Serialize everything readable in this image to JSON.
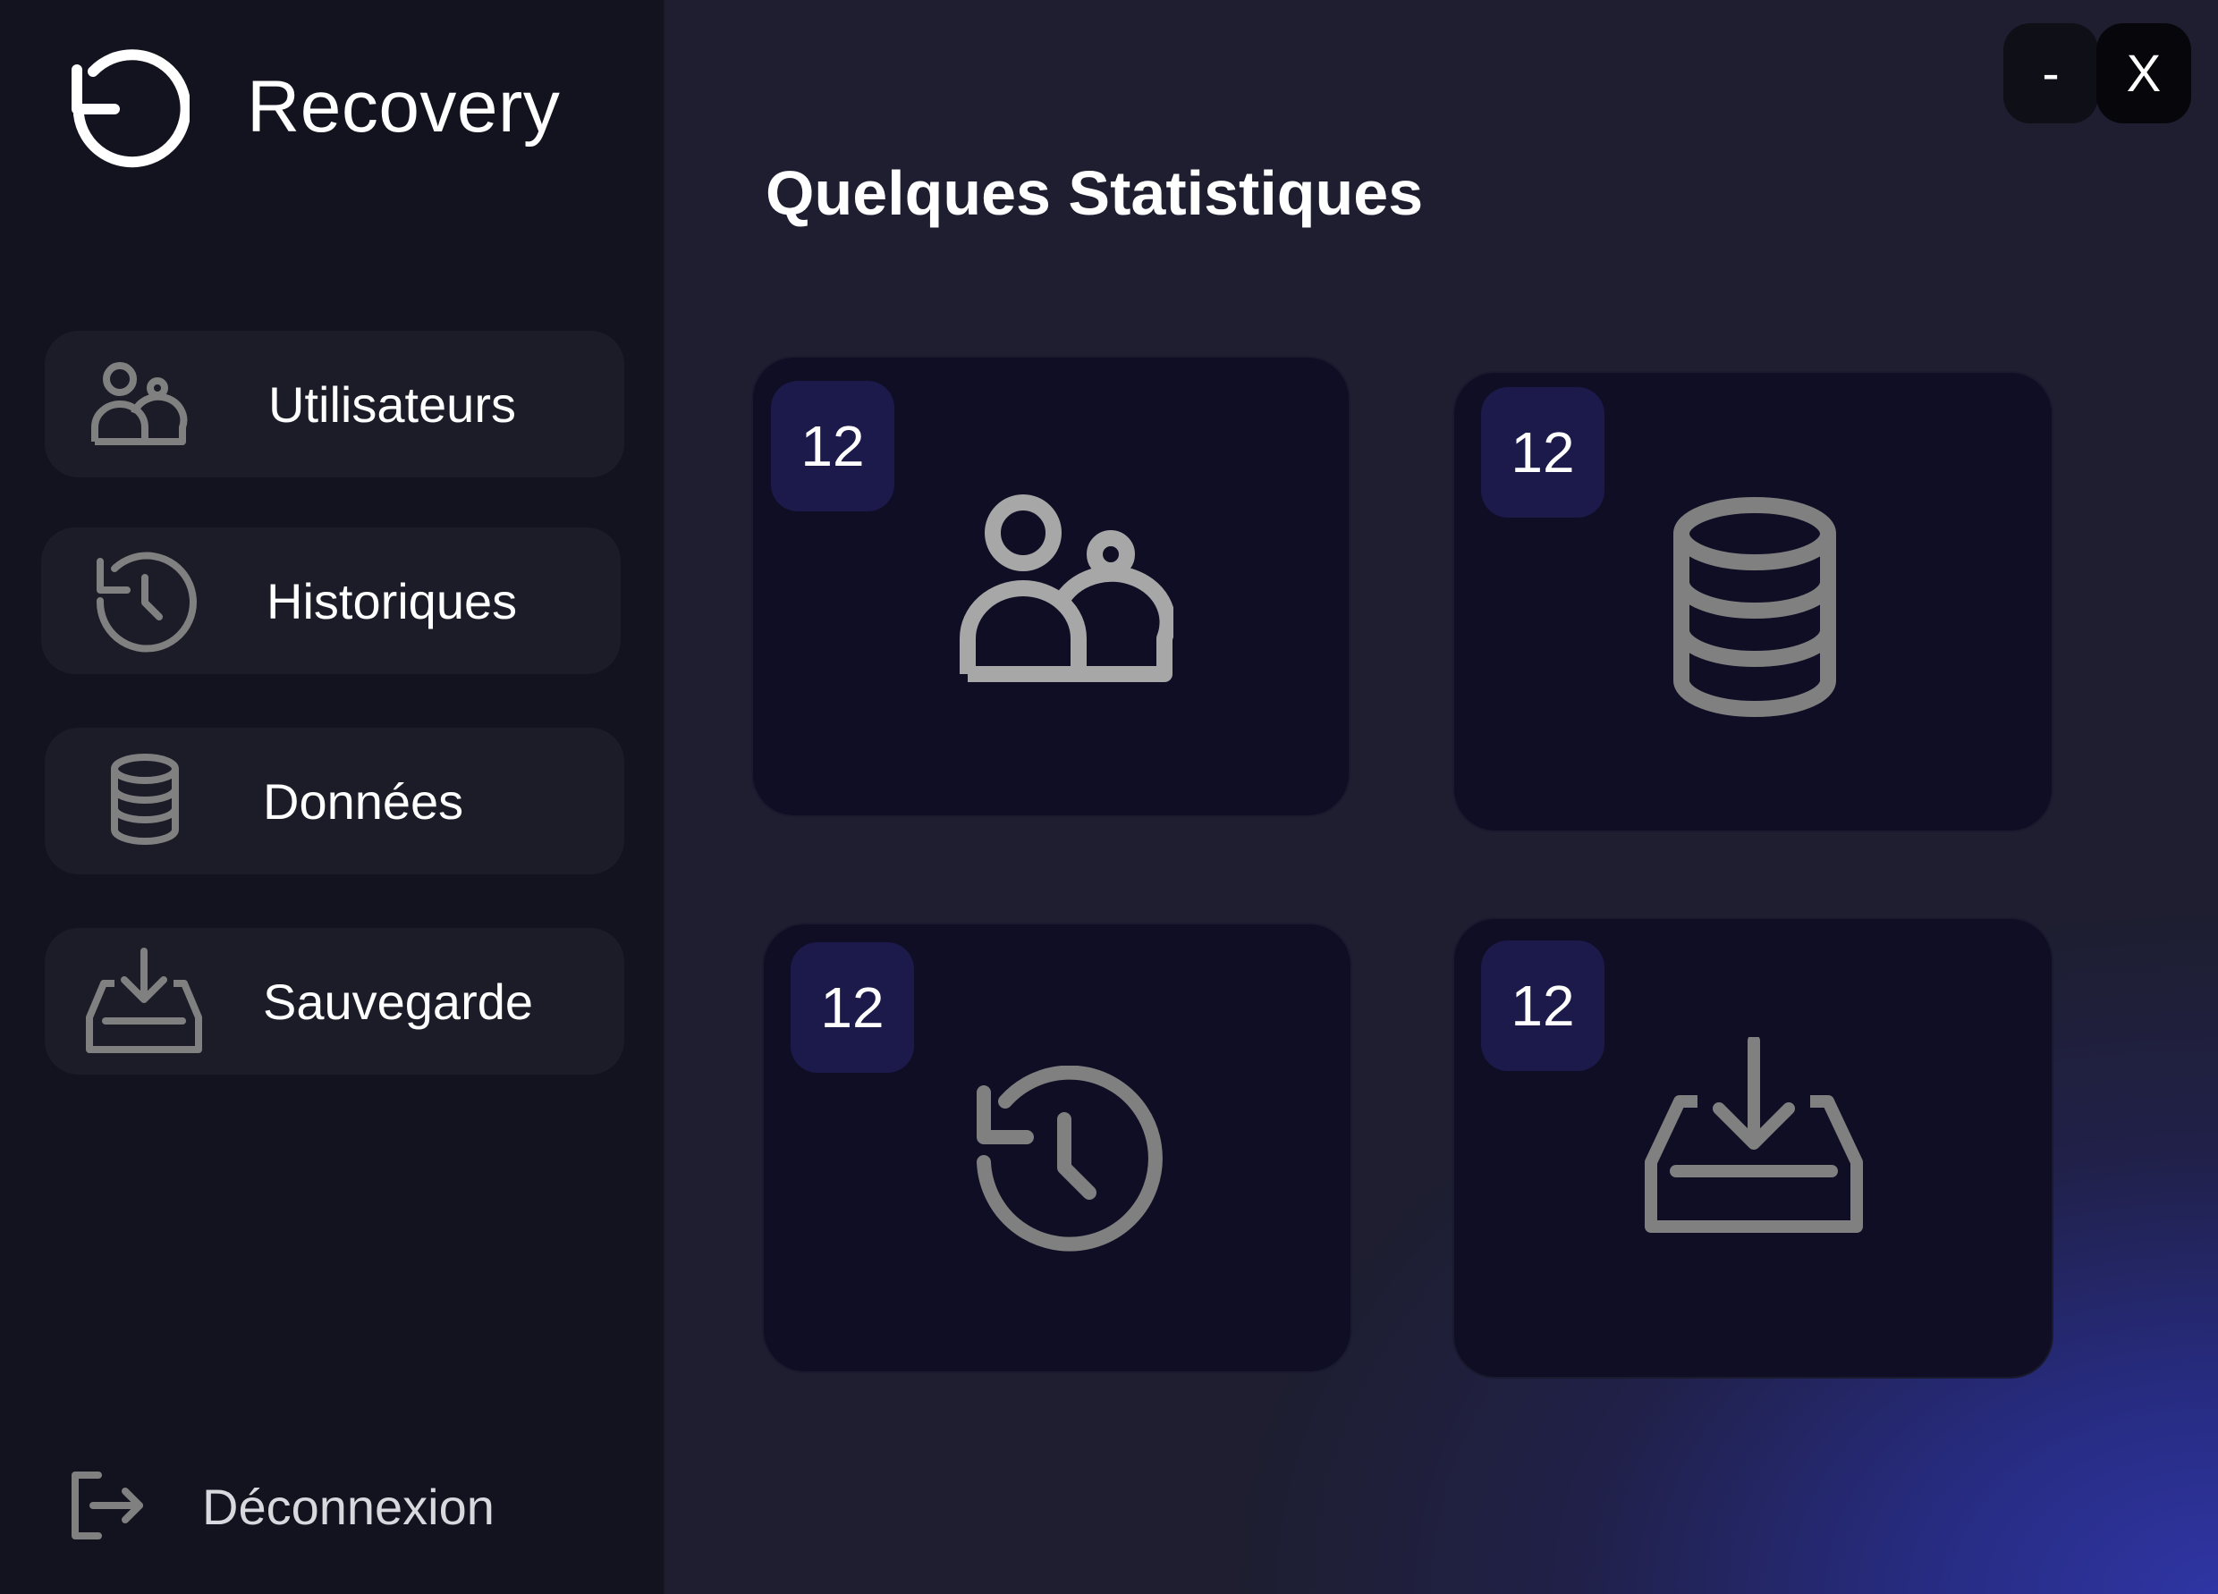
{
  "app": {
    "title": "Recovery",
    "icon": "refresh-ccw-icon"
  },
  "sidebar": {
    "items": [
      {
        "label": "Utilisateurs",
        "icon": "users-icon"
      },
      {
        "label": "Historiques",
        "icon": "history-icon"
      },
      {
        "label": "Données",
        "icon": "database-icon"
      },
      {
        "label": "Sauvegarde",
        "icon": "download-tray-icon"
      }
    ],
    "logout": {
      "label": "Déconnexion",
      "icon": "logout-icon"
    }
  },
  "window_controls": {
    "minimize_label": "-",
    "close_label": "X"
  },
  "main": {
    "title": "Quelques Statistiques",
    "cards": [
      {
        "value": "12",
        "icon": "users-icon"
      },
      {
        "value": "12",
        "icon": "database-icon"
      },
      {
        "value": "12",
        "icon": "history-icon"
      },
      {
        "value": "12",
        "icon": "download-tray-icon"
      }
    ]
  },
  "colors": {
    "sidebar_bg": "#13131f",
    "main_bg": "#1e1e30",
    "card_bg": "#0f0e24",
    "badge_bg": "#1c1a4a",
    "nav_item_bg": "#1c1c28",
    "icon_gray": "#808080",
    "accent_gradient": "#2f35a3"
  }
}
